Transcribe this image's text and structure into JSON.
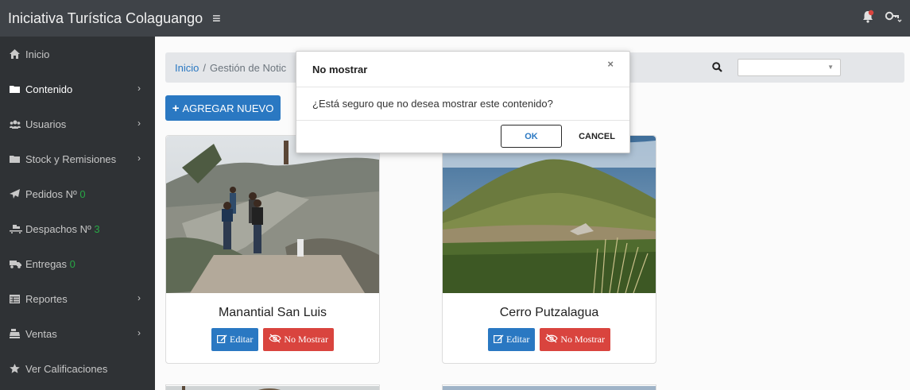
{
  "header": {
    "brand": "Iniciativa Turística Colaguango",
    "hamburger_icon": "bars-icon",
    "notification_icon": "bell-icon",
    "user_icon": "user-key-icon",
    "colors": {
      "topbar": "#3f4348",
      "notification": "#d9443e"
    }
  },
  "sidebar": {
    "items": [
      {
        "label": "Inicio",
        "icon": "home-icon",
        "badge": "",
        "has_chevron": false
      },
      {
        "label": "Contenido",
        "icon": "folder-icon",
        "badge": "",
        "has_chevron": true
      },
      {
        "label": "Usuarios",
        "icon": "users-icon",
        "badge": "",
        "has_chevron": true
      },
      {
        "label": "Stock y Remisiones",
        "icon": "folder-icon",
        "badge": "",
        "has_chevron": true
      },
      {
        "label": "Pedidos Nº",
        "icon": "paper-plane-icon",
        "badge": "0",
        "has_chevron": false
      },
      {
        "label": "Despachos Nº",
        "icon": "dolly-icon",
        "badge": "3",
        "has_chevron": false
      },
      {
        "label": "Entregas",
        "icon": "truck-icon",
        "badge": "0",
        "has_chevron": false
      },
      {
        "label": "Reportes",
        "icon": "table-icon",
        "badge": "",
        "has_chevron": true
      },
      {
        "label": "Ventas",
        "icon": "cash-register-icon",
        "badge": "",
        "has_chevron": true
      },
      {
        "label": "Ver Calificaciones",
        "icon": "star-icon",
        "badge": "",
        "has_chevron": false
      }
    ]
  },
  "breadcrumb": {
    "home": "Inicio",
    "separator": "/",
    "current": "Gestión de Notic"
  },
  "search": {
    "selected": ""
  },
  "toolbar": {
    "add_label": "AGREGAR NUEVO"
  },
  "cards": [
    {
      "title": "Manantial San Luis",
      "edit_label": "Editar",
      "hide_label": "No Mostrar"
    },
    {
      "title": "Cerro Putzalagua",
      "edit_label": "Editar",
      "hide_label": "No Mostrar"
    }
  ],
  "modal": {
    "title": "No mostrar",
    "close": "×",
    "message": "¿Está seguro que no desea mostrar este contenido?",
    "ok_label": "OK",
    "cancel_label": "CANCEL"
  }
}
